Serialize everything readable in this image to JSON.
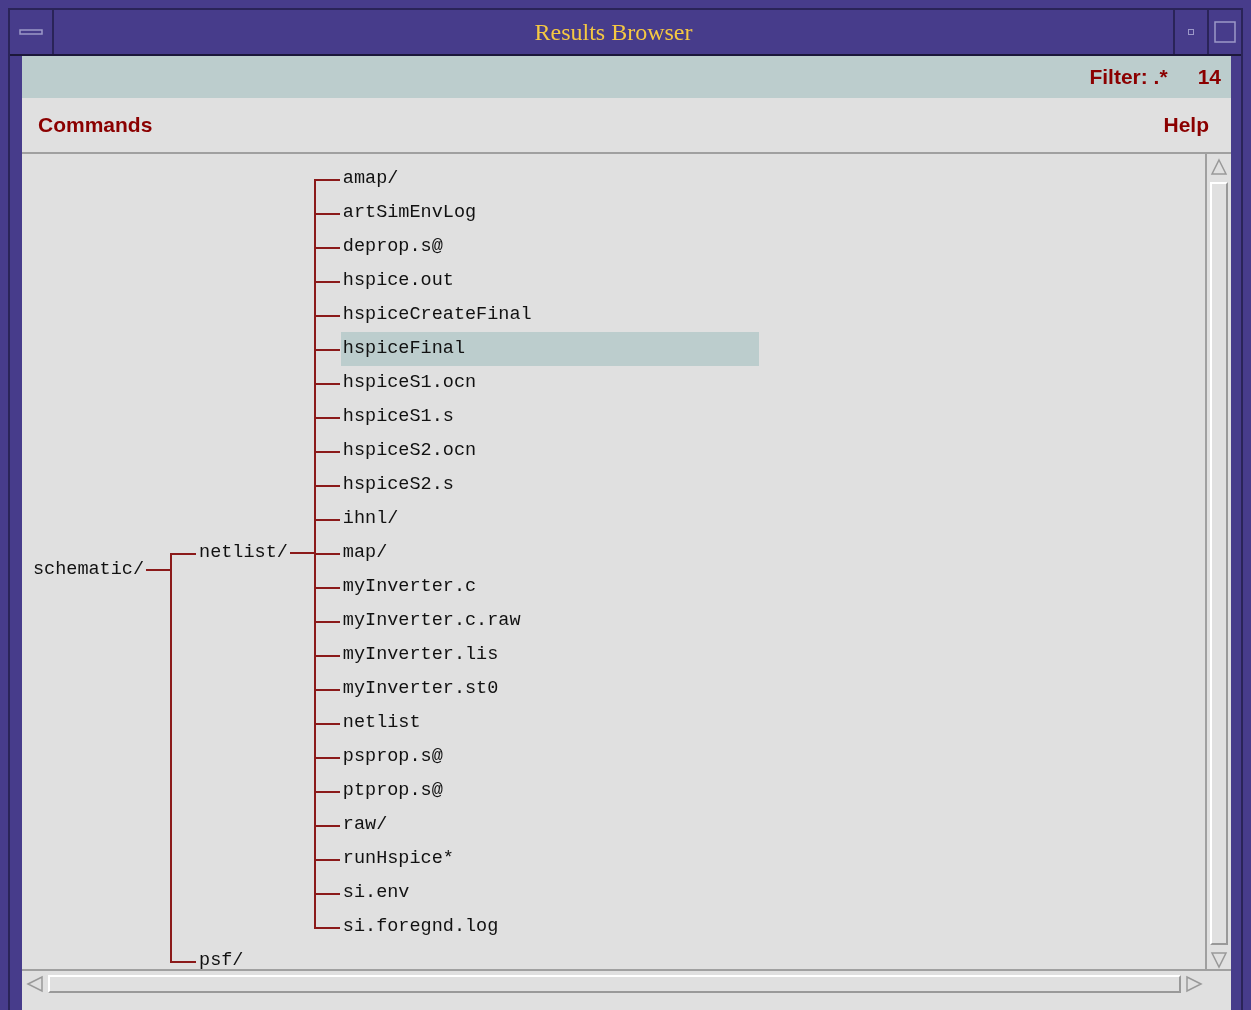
{
  "window": {
    "title": "Results Browser"
  },
  "filter_bar": {
    "filter": "Filter: .*",
    "count": "14"
  },
  "menu_bar": [
    {
      "label": "Commands"
    },
    {
      "label": "Help"
    }
  ],
  "tree": [
    {
      "label": "schematic/",
      "selected": false,
      "children": [
        {
          "label": "netlist/",
          "selected": false,
          "children": [
            {
              "label": "amap/",
              "selected": false
            },
            {
              "label": "artSimEnvLog",
              "selected": false
            },
            {
              "label": "deprop.s@",
              "selected": false
            },
            {
              "label": "hspice.out",
              "selected": false
            },
            {
              "label": "hspiceCreateFinal",
              "selected": false
            },
            {
              "label": "hspiceFinal",
              "selected": true
            },
            {
              "label": "hspiceS1.ocn",
              "selected": false
            },
            {
              "label": "hspiceS1.s",
              "selected": false
            },
            {
              "label": "hspiceS2.ocn",
              "selected": false
            },
            {
              "label": "hspiceS2.s",
              "selected": false
            },
            {
              "label": "ihnl/",
              "selected": false
            },
            {
              "label": "map/",
              "selected": false
            },
            {
              "label": "myInverter.c",
              "selected": false
            },
            {
              "label": "myInverter.c.raw",
              "selected": false
            },
            {
              "label": "myInverter.lis",
              "selected": false
            },
            {
              "label": "myInverter.st0",
              "selected": false
            },
            {
              "label": "netlist",
              "selected": false
            },
            {
              "label": "psprop.s@",
              "selected": false
            },
            {
              "label": "ptprop.s@",
              "selected": false
            },
            {
              "label": "raw/",
              "selected": false
            },
            {
              "label": "runHspice*",
              "selected": false
            },
            {
              "label": "si.env",
              "selected": false
            },
            {
              "label": "si.foregnd.log",
              "selected": false
            }
          ]
        },
        {
          "label": "psf/",
          "selected": false
        }
      ]
    }
  ]
}
